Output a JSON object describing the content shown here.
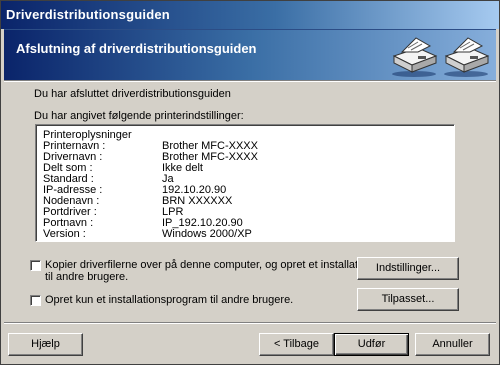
{
  "window": {
    "title": "Driverdistributionsguiden"
  },
  "banner": {
    "heading": "Afslutning af driverdistributionsguiden"
  },
  "intro": {
    "finished": "Du har afsluttet driverdistributionsguiden",
    "settings_intro": "Du har angivet følgende printerindstillinger:"
  },
  "printer_info": {
    "header": "Printeroplysninger",
    "rows": [
      {
        "key": "Printernavn :",
        "value": "Brother MFC-XXXX"
      },
      {
        "key": "Drivernavn :",
        "value": "Brother MFC-XXXX"
      },
      {
        "key": "Delt som :",
        "value": "Ikke delt"
      },
      {
        "key": "Standard :",
        "value": "Ja"
      },
      {
        "key": "IP-adresse :",
        "value": "192.10.20.90"
      },
      {
        "key": "Nodenavn :",
        "value": "BRN XXXXXX"
      },
      {
        "key": "Portdriver :",
        "value": "LPR"
      },
      {
        "key": "Portnavn :",
        "value": "IP_192.10.20.90"
      },
      {
        "key": "Version :",
        "value": "Windows 2000/XP"
      }
    ]
  },
  "options": {
    "copy_label_line1": "Kopier driverfilerne over på denne computer, og opret et installationsprogram",
    "copy_label_line2": "til andre brugere.",
    "copy_checked": false,
    "create_label": "Opret kun et installationsprogram til andre brugere.",
    "create_checked": false
  },
  "buttons": {
    "settings": "Indstillinger...",
    "customize": "Tilpasset...",
    "help": "Hjælp",
    "back": "< Tilbage",
    "finish": "Udfør",
    "cancel": "Annuller"
  },
  "icons": [
    "printer-icon",
    "printer-icon"
  ]
}
